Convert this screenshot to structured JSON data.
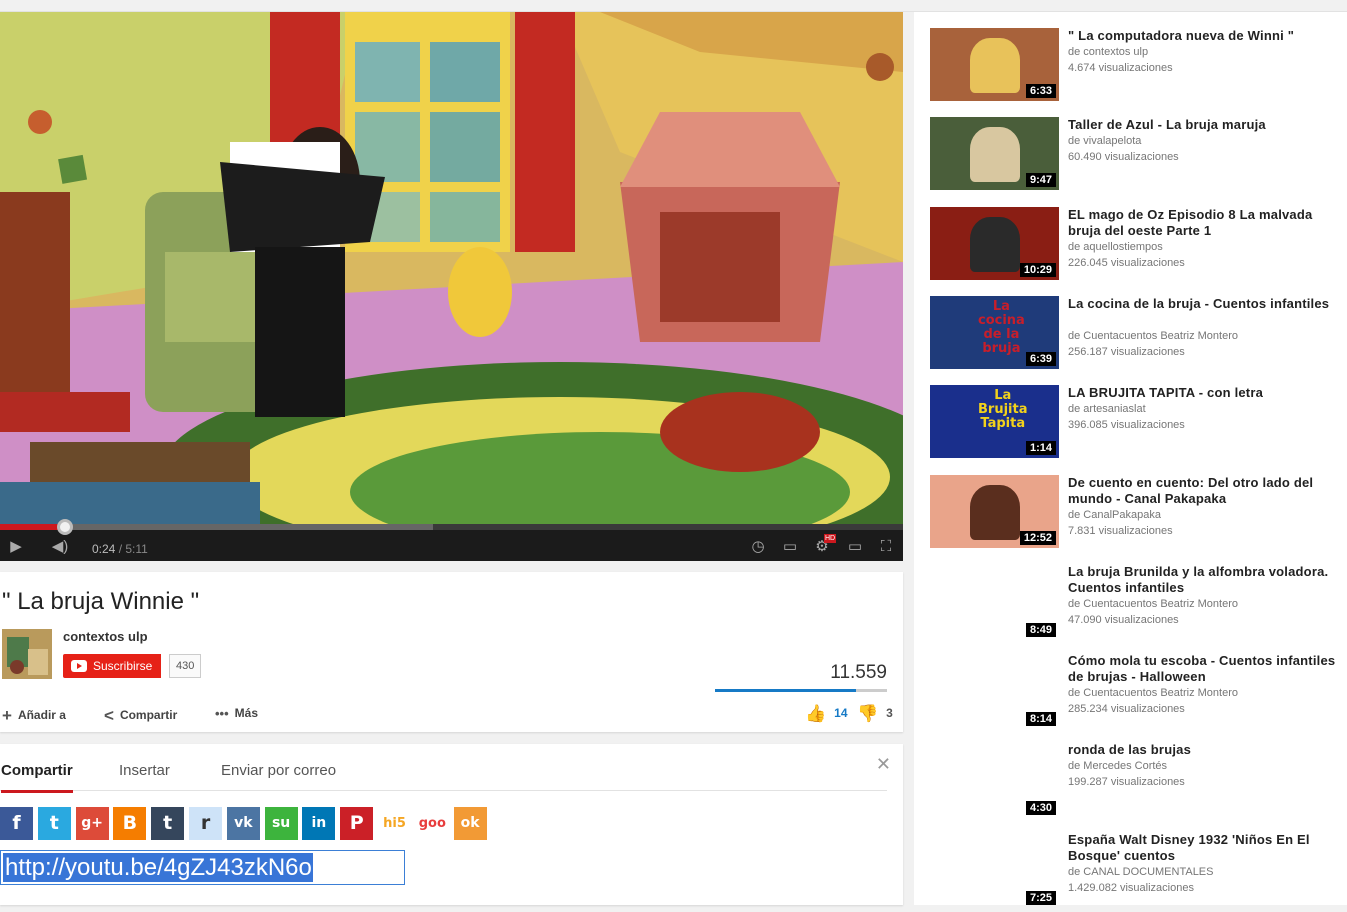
{
  "player": {
    "time_current": "0:24",
    "time_separator": " / ",
    "time_total": "5:11",
    "progress_played_fraction": 0.072,
    "progress_buffered_fraction": 0.48,
    "hd_badge": "HD"
  },
  "video": {
    "title": "\" La bruja Winnie \"",
    "channel": "contextos ulp",
    "subscribe_label": "Suscribirse",
    "subscriber_count": "430",
    "view_count": "11.559",
    "like_ratio_fraction": 0.82,
    "actions": {
      "add_label": "Añadir a",
      "share_label": "Compartir",
      "more_label": "Más"
    },
    "likes": "14",
    "dislikes": "3"
  },
  "share_panel": {
    "tabs": [
      "Compartir",
      "Insertar",
      "Enviar por correo"
    ],
    "active_tab": "Compartir",
    "close_icon": "close-icon",
    "social_buttons": [
      {
        "icon": "facebook-icon",
        "glyph": "f",
        "color": "#3b5998"
      },
      {
        "icon": "twitter-icon",
        "glyph": "t",
        "color": "#2aa9e0"
      },
      {
        "icon": "googleplus-icon",
        "glyph": "g+",
        "color": "#dd4b39"
      },
      {
        "icon": "blogger-icon",
        "glyph": "B",
        "color": "#f57d00"
      },
      {
        "icon": "tumblr-icon",
        "glyph": "t",
        "color": "#35465c"
      },
      {
        "icon": "reddit-icon",
        "glyph": "r",
        "color": "#cee3f8"
      },
      {
        "icon": "vk-icon",
        "glyph": "vk",
        "color": "#4c75a3"
      },
      {
        "icon": "stumbleupon-icon",
        "glyph": "su",
        "color": "#3db43d"
      },
      {
        "icon": "linkedin-icon",
        "glyph": "in",
        "color": "#0077b5"
      },
      {
        "icon": "pinterest-icon",
        "glyph": "P",
        "color": "#cb2027"
      },
      {
        "icon": "hi5-icon",
        "glyph": "hi5",
        "color": "#f5a623"
      },
      {
        "icon": "goo-icon",
        "glyph": "goo",
        "color": "#e83d3d"
      },
      {
        "icon": "odnoklassniki-icon",
        "glyph": "ok",
        "color": "#f29a35"
      }
    ],
    "share_url": "http://youtu.be/4gZJ43zkN6o"
  },
  "related": [
    {
      "title": "\" La computadora nueva de Winni \"",
      "channel": "de contextos ulp",
      "views": "4.674 visualizaciones",
      "duration": "6:33",
      "thumb_color": "#a8623b",
      "thumb_accent": "#e8c25a"
    },
    {
      "title": "Taller de Azul - La bruja maruja",
      "channel": "de vivalapelota",
      "views": "60.490 visualizaciones",
      "duration": "9:47",
      "thumb_color": "#4a5e3a",
      "thumb_accent": "#d8c7a0"
    },
    {
      "title": "EL mago de Oz Episodio 8 La malvada bruja del oeste Parte 1",
      "channel": "de aquellostiempos",
      "views": "226.045 visualizaciones",
      "duration": "10:29",
      "thumb_color": "#8a1e14",
      "thumb_accent": "#2a2a2a"
    },
    {
      "title": "La cocina de la bruja - Cuentos infantiles",
      "channel": "de Cuentacuentos Beatriz Montero",
      "views": "256.187 visualizaciones",
      "duration": "6:39",
      "thumb_color": "#1f3b7a",
      "thumb_accent": "#c81e2a",
      "thumb_text": [
        "La",
        "cocina",
        "de la",
        "bruja"
      ]
    },
    {
      "title": "LA BRUJITA TAPITA - con letra",
      "channel": "de artesaniaslat",
      "views": "396.085 visualizaciones",
      "duration": "1:14",
      "thumb_color": "#1a2f8c",
      "thumb_accent": "#f2d21b",
      "thumb_text": [
        "La",
        "Brujita",
        "Tapita"
      ]
    },
    {
      "title": "De cuento en cuento: Del otro lado del mundo - Canal Pakapaka",
      "channel": "de CanalPakapaka",
      "views": "7.831 visualizaciones",
      "duration": "12:52",
      "thumb_color": "#e9a48a",
      "thumb_accent": "#5a2e1e"
    },
    {
      "title": "La bruja Brunilda y la alfombra voladora. Cuentos infantiles",
      "channel": "de Cuentacuentos Beatriz Montero",
      "views": "47.090 visualizaciones",
      "duration": "8:49"
    },
    {
      "title": "Cómo mola tu escoba - Cuentos infantiles de brujas - Halloween",
      "channel": "de Cuentacuentos Beatriz Montero",
      "views": "285.234 visualizaciones",
      "duration": "8:14"
    },
    {
      "title": "ronda de las brujas",
      "channel": "de Mercedes Cortés",
      "views": "199.287 visualizaciones",
      "duration": "4:30"
    },
    {
      "title": "España Walt Disney 1932 'Niños En El Bosque' cuentos",
      "channel": "de CANAL DOCUMENTALES",
      "views": "1.429.082 visualizaciones",
      "duration": "7:25"
    }
  ]
}
